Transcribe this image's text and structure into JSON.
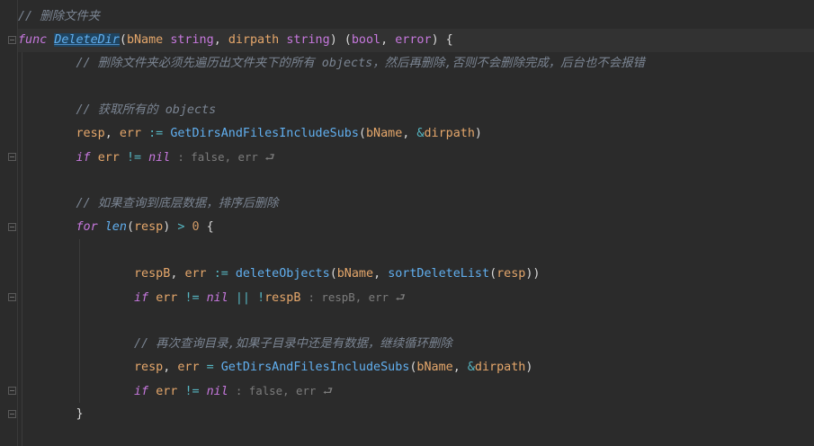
{
  "code": {
    "l1_comment": "// 删除文件夹",
    "l2": {
      "kw_func": "func",
      "name": "DeleteDir",
      "p1": "(",
      "a1": "bName",
      "t1": "string",
      "sep1": ", ",
      "a2": "dirpath",
      "t2": "string",
      "p2": ") (",
      "t3": "bool",
      "sep2": ", ",
      "t4": "error",
      "p3": ") {"
    },
    "l3_comment": "// 删除文件夹必须先遍历出文件夹下的所有 objects，然后再删除,否则不会删除完成，后台也不会报错",
    "l5_comment": "// 获取所有的 objects",
    "l6": {
      "v1": "resp",
      "sep": ", ",
      "v2": "err",
      "op": ":=",
      "fn": "GetDirsAndFilesIncludeSubs",
      "p1": "(",
      "a1": "bName",
      "sep2": ", ",
      "amp": "&",
      "a2": "dirpath",
      "p2": ")"
    },
    "l7": {
      "kw_if": "if",
      "v": "err",
      "op": "!=",
      "kw_nil": "nil",
      "hint": ": false, err ⮐"
    },
    "l9_comment": "// 如果查询到底层数据，排序后删除",
    "l10": {
      "kw_for": "for",
      "fn_len": "len",
      "p1": "(",
      "v": "resp",
      "p2": ")",
      "op": ">",
      "num": "0",
      "brace": "{"
    },
    "l12": {
      "v1": "respB",
      "sep": ", ",
      "v2": "err",
      "op": ":=",
      "fn1": "deleteObjects",
      "p1": "(",
      "a1": "bName",
      "sep2": ", ",
      "fn2": "sortDeleteList",
      "p2": "(",
      "a2": "resp",
      "p3": "))"
    },
    "l13": {
      "kw_if": "if",
      "v1": "err",
      "op1": "!=",
      "kw_nil": "nil",
      "op2": "||",
      "op3": "!",
      "v2": "respB",
      "hint": ": respB, err ⮐"
    },
    "l15_comment": "// 再次查询目录,如果子目录中还是有数据，继续循环删除",
    "l16": {
      "v1": "resp",
      "sep": ", ",
      "v2": "err",
      "op": "=",
      "fn": "GetDirsAndFilesIncludeSubs",
      "p1": "(",
      "a1": "bName",
      "sep2": ", ",
      "amp": "&",
      "a2": "dirpath",
      "p2": ")"
    },
    "l17": {
      "kw_if": "if",
      "v": "err",
      "op": "!=",
      "kw_nil": "nil",
      "hint": ": false, err ⮐"
    },
    "l18_brace": "}"
  }
}
